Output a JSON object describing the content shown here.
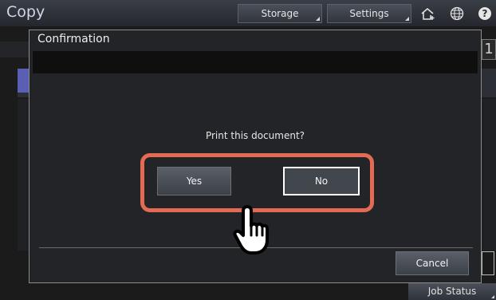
{
  "app": {
    "title": "Copy"
  },
  "topbar": {
    "tabs": [
      {
        "label": "Storage"
      },
      {
        "label": "Settings"
      }
    ],
    "icons": [
      "home-plus-icon",
      "globe-icon",
      "help-icon"
    ]
  },
  "background": {
    "copy_count": "1"
  },
  "dialog": {
    "title": "Confirmation",
    "question": "Print this document?",
    "yes_label": "Yes",
    "no_label": "No",
    "cancel_label": "Cancel",
    "selected_button": "No",
    "highlight_color": "#e46b53"
  },
  "footer": {
    "job_status_label": "Job Status"
  }
}
